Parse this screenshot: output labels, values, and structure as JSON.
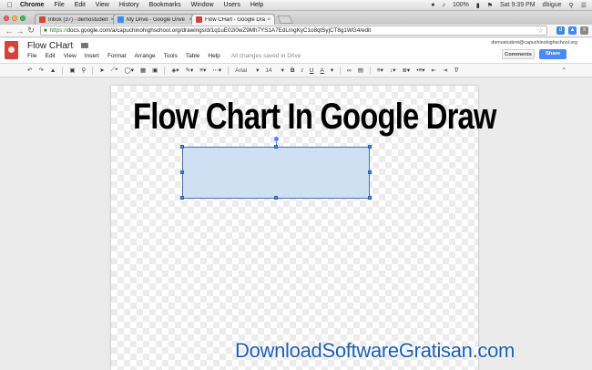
{
  "mac_menu": {
    "app": "Chrome",
    "items": [
      "File",
      "Edit",
      "View",
      "History",
      "Bookmarks",
      "Window",
      "Users",
      "Help"
    ],
    "battery": "100%",
    "clock": "Sat 9:39 PM",
    "user": "dbigue"
  },
  "tabs": [
    {
      "title": "Inbox (37) - demostudent@...",
      "color": "#d44638"
    },
    {
      "title": "My Drive - Google Drive",
      "color": "#3d8af7"
    },
    {
      "title": "Flow CHart - Google Draw...",
      "color": "#d0443b"
    }
  ],
  "address": {
    "scheme": "https://",
    "rest": "docs.google.com/a/capuchinohighschool.org/drawings/d/1q1uE02i0wZ9Mh7YS1A7EdLmgKyC1o8qtSyjCT8g1WG4/edit"
  },
  "doc": {
    "title": "Flow CHart",
    "account": "demostudent@capuchinohighschool.org",
    "comments_label": "Comments",
    "share_label": "Share",
    "menu": [
      "File",
      "Edit",
      "View",
      "Insert",
      "Format",
      "Arrange",
      "Tools",
      "Table",
      "Help"
    ],
    "save_status": "All changes saved in Drive"
  },
  "toolbar": {
    "font": "Arial",
    "font_size": "14",
    "bold": "B",
    "italic": "I",
    "underline": "U",
    "text_color": "A"
  },
  "canvas": {
    "headline": "Flow Chart In Google Draw",
    "shape_fill": "#cfe0f3"
  },
  "watermark": "DownloadSoftwareGratisan.com"
}
